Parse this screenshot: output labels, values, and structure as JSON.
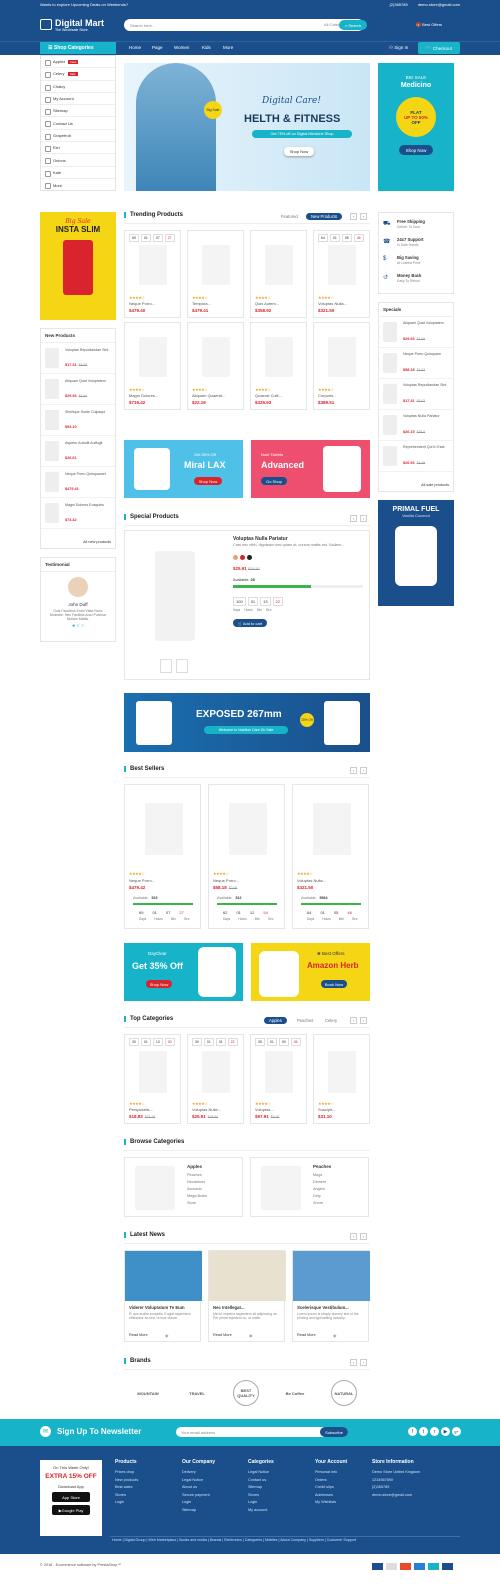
{
  "topbar": {
    "promo": "Wants to explore Upcoming Deals on Weekends?",
    "phone": "(2)365789",
    "email": "demo.store@gmail.com"
  },
  "header": {
    "logo_title": "Digital Mart",
    "logo_tagline": "The Wholesale Store",
    "search_placeholder": "Search here...",
    "search_category": "All Categories",
    "search_button": "Search",
    "offers": "Best Offers"
  },
  "nav": {
    "categories_label": "Shop Categories",
    "items": [
      "Home",
      "Page",
      "Women",
      "Kids",
      "More"
    ],
    "signin": "Sign In",
    "checkout": "Checkout"
  },
  "sidebar": {
    "items": [
      "Applez",
      "Celery",
      "Chaicy",
      "My Account",
      "Sitemap",
      "Contact Us",
      "Grapefruit",
      "Eiei",
      "Onions",
      "Kale",
      "More"
    ],
    "badges": [
      "New",
      "Sale"
    ]
  },
  "hero": {
    "script": "Digital Care!",
    "title": "HELTH & FITNESS",
    "subtitle": "Get 75% off on Digital Medicine Shop",
    "button": "Shop Now",
    "badge": "Big Sale"
  },
  "promo_right": {
    "label": "BIG SALE",
    "title": "Medicino",
    "flat": "FLAT",
    "upto": "UP TO 50%",
    "off": "OFF",
    "button": "Shop Now"
  },
  "left_banner": {
    "script": "Big Sale",
    "title": "INSTA SLIM"
  },
  "new_products": {
    "title": "New Products",
    "items": [
      {
        "name": "Voluptas Repudiandae Sint",
        "price": "$17.31",
        "old": "$3.08"
      },
      {
        "name": "Aliquam Quat Voluptatem",
        "price": "$29.93",
        "old": "$1.00"
      },
      {
        "name": "Similique Sunte Culpaqui",
        "price": "$93.10"
      },
      {
        "name": "Aspetur Autodit Autfugit",
        "price": "$26.61"
      },
      {
        "name": "Neque Porro Quisquamet",
        "price": "$479.41"
      },
      {
        "name": "Magni Dolores Eosquies",
        "price": "$74.42"
      }
    ],
    "all": "All new products"
  },
  "testimonial": {
    "title": "Testimonial",
    "name": "John Duff",
    "text": "Duis Faucibus Enim Vitae Nunc Molestie. Nec Facilisis Arcu Pulvinar Nullam Mattis."
  },
  "trending": {
    "title": "Trending Products",
    "tab_featured": "Featured",
    "tab_new": "New Products",
    "products": [
      {
        "name": "Neque Porro...",
        "price": "$479.40",
        "cd": [
          "69",
          "01",
          "07",
          "27"
        ]
      },
      {
        "name": "Tempora...",
        "price": "$479.41"
      },
      {
        "name": "Quis Autem...",
        "price": "$358.92"
      },
      {
        "name": "Voluptas Nulla...",
        "price": "$321.50",
        "cd": [
          "64",
          "01",
          "05",
          "46"
        ]
      },
      {
        "name": "Magni Dolores...",
        "price": "$716.42"
      },
      {
        "name": "Aliquam Quaerat...",
        "price": "$22.19"
      },
      {
        "name": "Quaerat Culti...",
        "price": "$326.93"
      },
      {
        "name": "Corporis...",
        "price": "$389.51"
      }
    ]
  },
  "services": [
    {
      "title": "Free Shipping",
      "sub": "Deliver To Door"
    },
    {
      "title": "24x7 Support",
      "sub": "In Safe Hands"
    },
    {
      "title": "Big Saving",
      "sub": "At Lowest Price"
    },
    {
      "title": "Money Back",
      "sub": "Easy To Return"
    }
  ],
  "specials_side": {
    "title": "Specials",
    "items": [
      {
        "name": "Aliquam Quat Voluptatem",
        "price": "$29.93",
        "old": "$1.00"
      },
      {
        "name": "Neque Porro Quisquam",
        "price": "$58.18",
        "old": "$2.03"
      },
      {
        "name": "Voluptas Repudiandae Sint",
        "price": "$17.31",
        "old": "$3.03"
      },
      {
        "name": "Voluptas Nulla Pariatur",
        "price": "$26.15",
        "old": "$28.5"
      },
      {
        "name": "Reprehenderit Qui In Esat",
        "price": "$26.93",
        "old": "$4.08"
      }
    ],
    "all": "All sale products"
  },
  "mini_banners": [
    {
      "label": "Get 30% Off",
      "title": "Miral LAX",
      "button": "Shop Now"
    },
    {
      "label": "Nutri Tablets",
      "title": "Advanced",
      "button": "Go Shop"
    }
  ],
  "primal": {
    "title": "PRIMAL FUEL",
    "sub": "Vanilla Coconut"
  },
  "special_products": {
    "title": "Special Products",
    "name": "Voluptas Nulla Pariatur",
    "desc": "Cras nec nibh, dignissim sed quam ut, cursus mattis est. Nullam...",
    "price": "$25.91",
    "old": "$28.50",
    "available_label": "Available:",
    "available": "28",
    "availability_fraction": 0.6,
    "cd": [
      "100",
      "01",
      "13",
      "22"
    ],
    "cd_labels": [
      "Days",
      "Hours",
      "Min",
      "Sec"
    ],
    "button": "Add to cart"
  },
  "exposed": {
    "title": "EXPOSED 267mm",
    "button": "Welcome to Nutrition Care On Sale",
    "badge": "30% Off"
  },
  "best_sellers": {
    "title": "Best Sellers",
    "products": [
      {
        "name": "Neque Porro...",
        "price": "$479.42",
        "available": "519",
        "cd": [
          "69",
          "01",
          "07",
          "27"
        ]
      },
      {
        "name": "Neque Porro...",
        "price": "$58.18",
        "old": "$2.08",
        "available": "512",
        "cd": [
          "62",
          "01",
          "12",
          "54"
        ]
      },
      {
        "name": "Voluptas Nulla...",
        "price": "$321.50",
        "available": "5964",
        "cd": [
          "64",
          "01",
          "05",
          "46"
        ]
      }
    ],
    "available_label": "Available:"
  },
  "banners2": [
    {
      "label": "DayClear",
      "title": "Get 35% Off",
      "button": "Shop Now"
    },
    {
      "label": "Best Offers",
      "title": "Amazon Herb",
      "button": "Book Now"
    }
  ],
  "top_categories": {
    "title": "Top Categories",
    "tabs": [
      "Apples",
      "Peaches",
      "Celery"
    ],
    "products": [
      {
        "name": "Perspiciatis...",
        "price": "$18.83",
        "old": "$23.18",
        "cd": [
          "30",
          "01",
          "13",
          "30"
        ]
      },
      {
        "name": "Voluptas Nulla...",
        "price": "$25.91",
        "old": "$28.50",
        "cd": [
          "30",
          "01",
          "01",
          "22"
        ]
      },
      {
        "name": "Voluptas...",
        "price": "$97.91",
        "old": "$3.00",
        "cd": [
          "35",
          "01",
          "00",
          "36"
        ]
      },
      {
        "name": "Suscipit...",
        "price": "$31.10"
      }
    ]
  },
  "browse": {
    "title": "Browse Categories",
    "cats": [
      {
        "name": "Apples",
        "items": [
          "Peaches",
          "Nectarines",
          "Avocado",
          "Mega Bulbs",
          "Store"
        ]
      },
      {
        "name": "Peaches",
        "items": [
          "Mugs",
          "Dinnere",
          "Angelo",
          "Dirty",
          "Shore"
        ]
      }
    ]
  },
  "news": {
    "title": "Latest News",
    "items": [
      {
        "title": "Viderer Voluptatum Te Eum",
        "text": "Ei quo audire euripidis. Eugiat sapientem efficiantur an sea, ut inve dolore.",
        "more": "Read More"
      },
      {
        "title": "Nec Intellegat...",
        "text": "Mel ut impetus sapientem sit adipiscing ne. Per prima equidem cu, ut oratio.",
        "more": "Read More"
      },
      {
        "title": "Scelerisque Vestibulum...",
        "text": "Lorem Ipsum is simply dummy text of the printing and typesetting industry.",
        "more": "Read More"
      }
    ]
  },
  "brands": {
    "title": "Brands",
    "items": [
      "MOUNTAIN",
      "TRAVEL",
      "BEST QUALITY",
      "Be Coffee",
      "NATURAL"
    ]
  },
  "newsletter": {
    "title": "Sign Up To Newsletter",
    "placeholder": "Your email address",
    "button": "Subscribe"
  },
  "footer": {
    "offer": {
      "top": "On This Week Only!",
      "title": "EXTRA 15% OFF",
      "app": "Download App",
      "appstore": "App Store",
      "googleplay": "Google Play"
    },
    "cols": [
      {
        "title": "Products",
        "links": [
          "Prices drop",
          "New products",
          "Best sales",
          "Stores",
          "Login"
        ]
      },
      {
        "title": "Our Company",
        "links": [
          "Delivery",
          "Legal Notice",
          "About us",
          "Secure payment",
          "Login",
          "Sitemap"
        ]
      },
      {
        "title": "Categories",
        "links": [
          "Legal Notice",
          "Contact us",
          "Sitemap",
          "Stores",
          "Login",
          "My account"
        ]
      },
      {
        "title": "Your Account",
        "links": [
          "Personal info",
          "Orders",
          "Credit slips",
          "Addresses",
          "My Wishlists"
        ]
      },
      {
        "title": "Store Information",
        "links": [
          "Demo Store United Kingdom",
          "1234567890",
          "(2)365789",
          "demo.store@gmail.com"
        ]
      }
    ],
    "bottom_links": "Home | Digital Group | Web Marketplace | Books and media | Brands | Electronics | Categories | Mobiles | About Company | Suppliers | Customer Support",
    "copyright": "© 2018 - Ecommerce software by PrestaShop™"
  }
}
